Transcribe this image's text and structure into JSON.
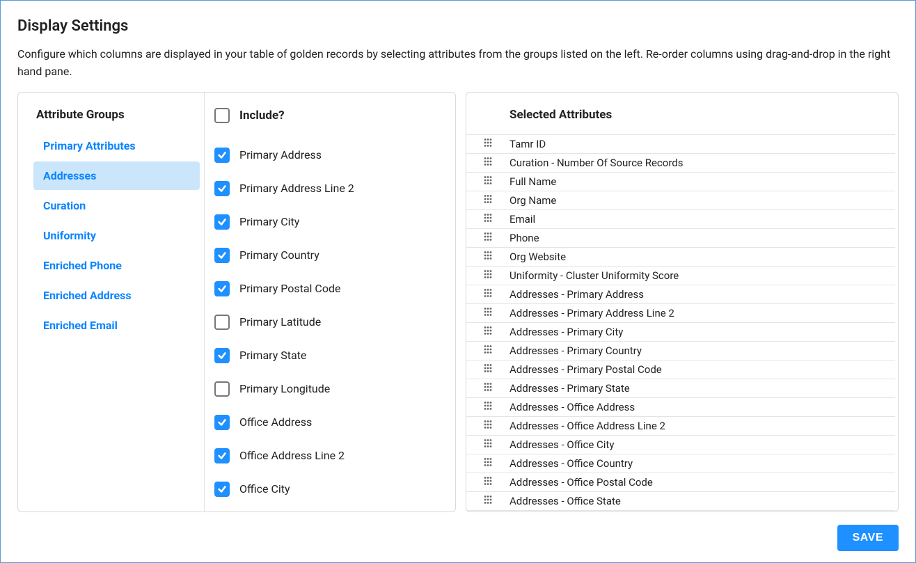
{
  "title": "Display Settings",
  "description": "Configure which columns are displayed in your table of golden records by selecting attributes from the groups listed on the left. Re-order columns using drag-and-drop in the right hand pane.",
  "groups_header": "Attribute Groups",
  "groups": [
    {
      "label": "Primary Attributes",
      "selected": false
    },
    {
      "label": "Addresses",
      "selected": true
    },
    {
      "label": "Curation",
      "selected": false
    },
    {
      "label": "Uniformity",
      "selected": false
    },
    {
      "label": "Enriched Phone",
      "selected": false
    },
    {
      "label": "Enriched Address",
      "selected": false
    },
    {
      "label": "Enriched Email",
      "selected": false
    }
  ],
  "include_header": "Include?",
  "attributes": [
    {
      "label": "Primary Address",
      "checked": true
    },
    {
      "label": "Primary Address Line 2",
      "checked": true
    },
    {
      "label": "Primary City",
      "checked": true
    },
    {
      "label": "Primary Country",
      "checked": true
    },
    {
      "label": "Primary Postal Code",
      "checked": true
    },
    {
      "label": "Primary Latitude",
      "checked": false
    },
    {
      "label": "Primary State",
      "checked": true
    },
    {
      "label": "Primary Longitude",
      "checked": false
    },
    {
      "label": "Office Address",
      "checked": true
    },
    {
      "label": "Office Address Line 2",
      "checked": true
    },
    {
      "label": "Office City",
      "checked": true
    }
  ],
  "selected_header": "Selected Attributes",
  "selected": [
    {
      "label": "Tamr ID"
    },
    {
      "label": "Curation - Number Of Source Records"
    },
    {
      "label": "Full Name"
    },
    {
      "label": "Org Name"
    },
    {
      "label": "Email"
    },
    {
      "label": "Phone"
    },
    {
      "label": "Org Website"
    },
    {
      "label": "Uniformity - Cluster Uniformity Score"
    },
    {
      "label": "Addresses - Primary Address"
    },
    {
      "label": "Addresses - Primary Address Line 2"
    },
    {
      "label": "Addresses - Primary City"
    },
    {
      "label": "Addresses - Primary Country"
    },
    {
      "label": "Addresses - Primary Postal Code"
    },
    {
      "label": "Addresses - Primary State"
    },
    {
      "label": "Addresses - Office Address"
    },
    {
      "label": "Addresses - Office Address Line 2"
    },
    {
      "label": "Addresses - Office City"
    },
    {
      "label": "Addresses - Office Country"
    },
    {
      "label": "Addresses - Office Postal Code"
    },
    {
      "label": "Addresses - Office State"
    }
  ],
  "save_label": "SAVE"
}
